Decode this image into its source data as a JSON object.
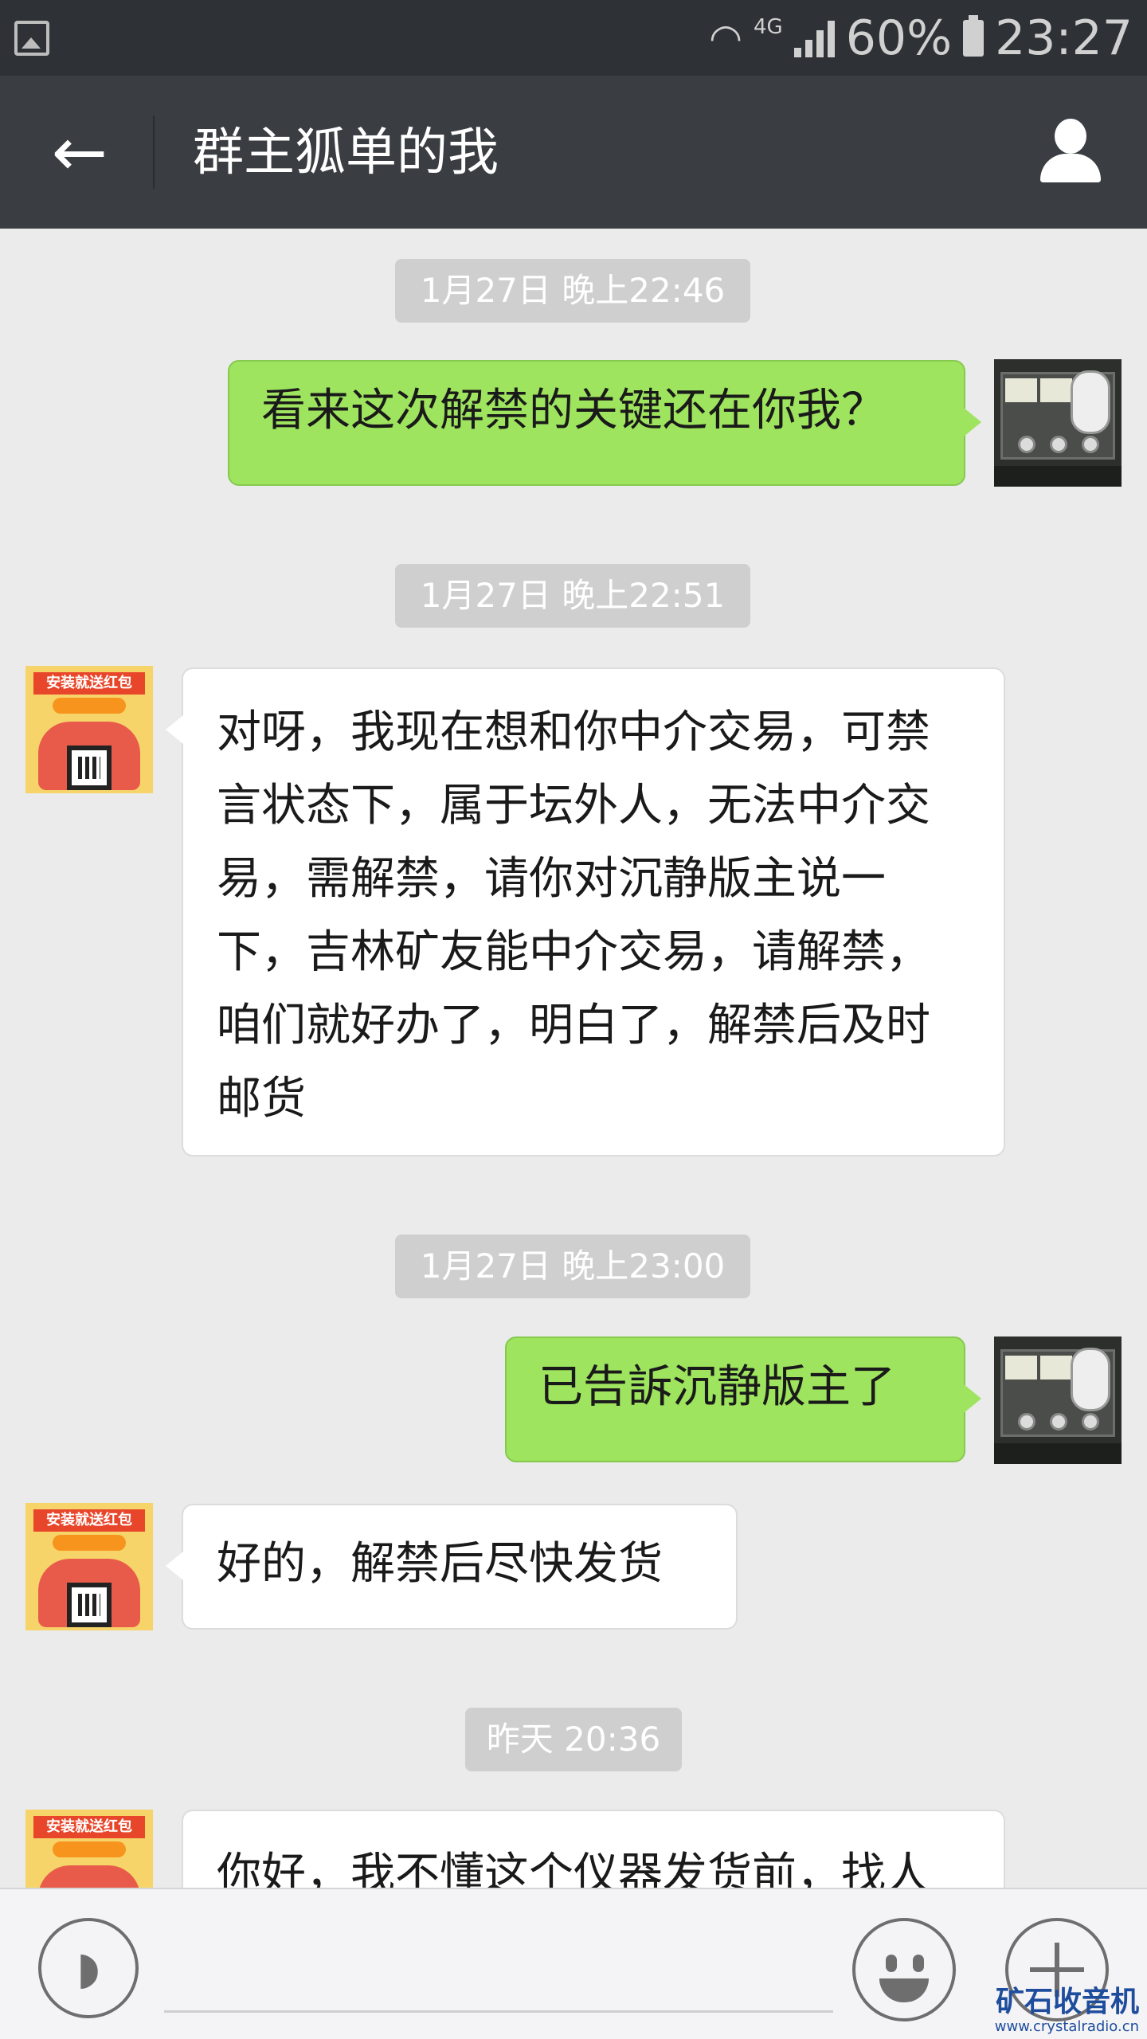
{
  "status_bar": {
    "network": "4G",
    "battery": "60%",
    "time": "23:27"
  },
  "header": {
    "title": "群主狐单的我"
  },
  "messages": [
    {
      "type": "timestamp",
      "text": "1月27日 晚上22:46"
    },
    {
      "type": "outgoing",
      "text": "看来这次解禁的关键还在你我？"
    },
    {
      "type": "timestamp",
      "text": "1月27日 晚上22:51"
    },
    {
      "type": "incoming",
      "lines": [
        "对呀，我现在想和你中介交易，可禁",
        "言状态下，属于坛外人，无法中介交",
        "易，需解禁，请你对沉静版主说一",
        "下，吉林矿友能中介交易，请解禁，",
        "咱们就好办了，明白了，解禁后及时",
        "邮货"
      ]
    },
    {
      "type": "timestamp",
      "text": "1月27日 晚上23:00"
    },
    {
      "type": "outgoing",
      "text": "已告訴沉静版主了"
    },
    {
      "type": "incoming",
      "text": "好的，解禁后尽快发货"
    },
    {
      "type": "timestamp",
      "text": "昨天 20:36"
    },
    {
      "type": "incoming",
      "text": "你好，我不懂这个仪器发货前，找人"
    }
  ],
  "avatars": {
    "promo_banner": "安装就送红包"
  },
  "watermark": {
    "title": "矿石收音机",
    "url": "www.crystalradio.cn"
  }
}
